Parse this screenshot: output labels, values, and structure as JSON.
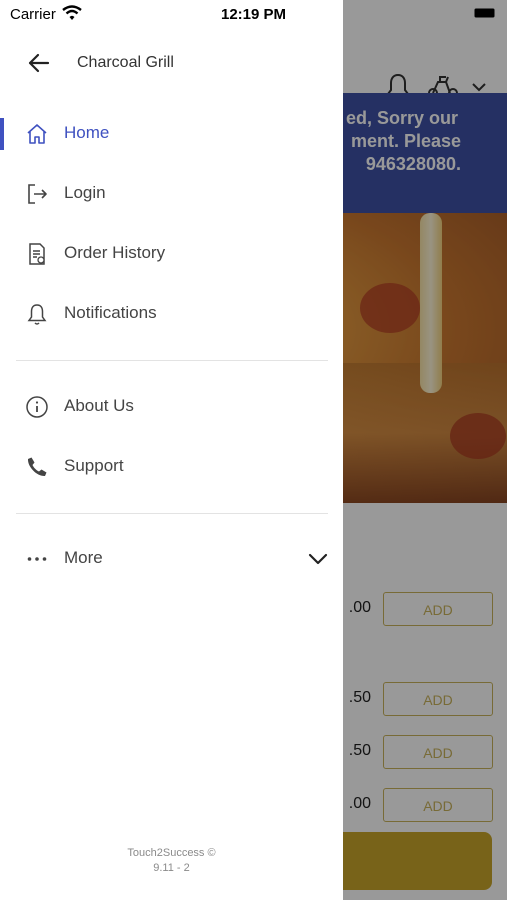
{
  "status_bar": {
    "carrier": "Carrier",
    "time": "12:19 PM"
  },
  "drawer": {
    "title": "Charcoal Grill",
    "items": [
      {
        "label": "Home",
        "icon": "home-icon",
        "active": true
      },
      {
        "label": "Login",
        "icon": "login-icon"
      },
      {
        "label": "Order History",
        "icon": "receipt-icon"
      },
      {
        "label": "Notifications",
        "icon": "bell-icon"
      },
      {
        "label": "About Us",
        "icon": "info-icon"
      },
      {
        "label": "Support",
        "icon": "phone-icon"
      },
      {
        "label": "More",
        "icon": "ellipsis-icon"
      }
    ],
    "footer": {
      "line1": "Touch2Success ©",
      "line2": "9.11 - 2"
    }
  },
  "background": {
    "banner_lines": [
      "ed, Sorry our",
      "ment. Please",
      "946328080."
    ],
    "prices": [
      ".00",
      ".50",
      ".50",
      ".00"
    ],
    "add_label": "ADD"
  },
  "colors": {
    "accent": "#3f51c0",
    "banner": "#3f51a6",
    "add_border": "#c9b25c",
    "cart": "#c9a62b"
  }
}
